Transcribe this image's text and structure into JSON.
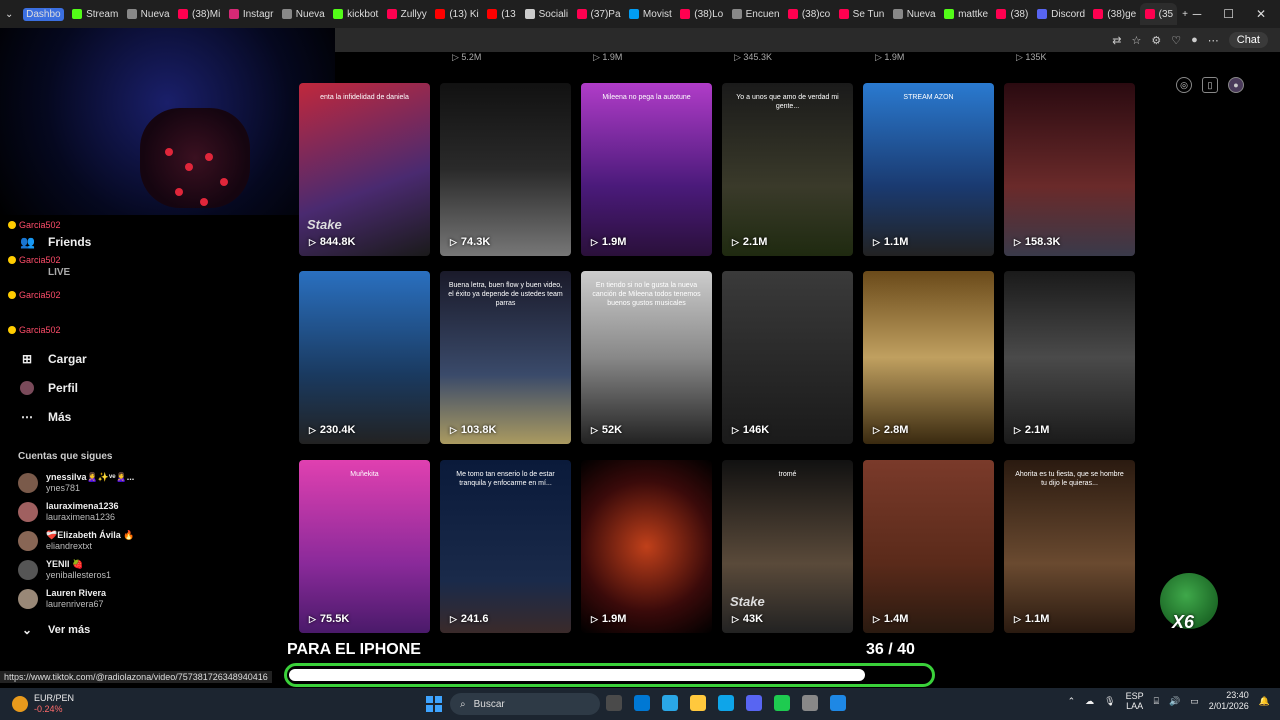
{
  "browser": {
    "tabs": [
      {
        "label": "Dashbo",
        "color": "#3b6fe0",
        "active": false
      },
      {
        "label": "Stream",
        "color": "#53fc18"
      },
      {
        "label": "Nueva",
        "color": "#888888"
      },
      {
        "label": "(38)Mi",
        "color": "#ff0050"
      },
      {
        "label": "Instagr",
        "color": "#d62976"
      },
      {
        "label": "Nueva",
        "color": "#888888"
      },
      {
        "label": "kickbot",
        "color": "#53fc18"
      },
      {
        "label": "Zullyy",
        "color": "#ff0050"
      },
      {
        "label": "(13) Ki",
        "color": "#ff0000"
      },
      {
        "label": "(13",
        "color": "#ff0000"
      },
      {
        "label": "Sociali",
        "color": "#cccccc"
      },
      {
        "label": "(37)Pa",
        "color": "#ff0050"
      },
      {
        "label": "Movist",
        "color": "#019df4"
      },
      {
        "label": "(38)Lo",
        "color": "#ff0050"
      },
      {
        "label": "Encuen",
        "color": "#888888"
      },
      {
        "label": "(38)co",
        "color": "#ff0050"
      },
      {
        "label": "Se Tun",
        "color": "#ff0050"
      },
      {
        "label": "Nueva",
        "color": "#888888"
      },
      {
        "label": "mattke",
        "color": "#53fc18"
      },
      {
        "label": "(38)",
        "color": "#ff0050"
      },
      {
        "label": "Discord",
        "color": "#5865f2"
      },
      {
        "label": "(38)ge",
        "color": "#ff0050"
      },
      {
        "label": "(35",
        "color": "#ff0050",
        "active": true
      }
    ],
    "chat_label": "Chat"
  },
  "sidebar": {
    "donors": [
      "Garcia502",
      "Garcia502",
      "Garcia502",
      "Garcia502"
    ],
    "items": [
      {
        "label": "Friends",
        "icon": "friends-icon",
        "glyph": "♟"
      },
      {
        "label": "LIVE",
        "icon": "live-icon",
        "glyph": ""
      },
      {
        "label": "Cargar",
        "icon": "upload-icon",
        "glyph": "➕"
      },
      {
        "label": "Perfil",
        "icon": "profile-icon",
        "glyph": "●"
      },
      {
        "label": "Más",
        "icon": "more-icon",
        "glyph": "⋯"
      }
    ],
    "following_title": "Cuentas que sigues",
    "accounts": [
      {
        "name": "ynessilva🙎‍♀️✨ᵛᵉ🙎‍♀️...",
        "handle": "ynes781",
        "color": "#7a5a4a"
      },
      {
        "name": "lauraximena1236",
        "handle": "lauraximena1236",
        "color": "#a06060"
      },
      {
        "name": "❤️‍🩹Elizabeth Ávila 🔥",
        "handle": "eliandrextxt",
        "color": "#886655"
      },
      {
        "name": "YENII 🍓",
        "handle": "yeniballesteros1",
        "color": "#555555"
      },
      {
        "name": "Lauren Rivera",
        "handle": "laurenrivera67",
        "color": "#998877"
      }
    ],
    "see_more": "Ver más"
  },
  "top_views": [
    "5.2M",
    "1.9M",
    "345.3K",
    "1.9M",
    "135K"
  ],
  "videos": [
    {
      "views": "844.8K",
      "caption": "enta la infidelidad de daniela",
      "bg": "linear-gradient(160deg,#c0283c,#4a2a70 60%,#1a1a1a)",
      "stake": true
    },
    {
      "views": "74.3K",
      "caption": "",
      "bg": "linear-gradient(180deg,#111,#2a2a2a 50%,#777)"
    },
    {
      "views": "1.9M",
      "caption": "Mileena no pega la autotune",
      "bg": "linear-gradient(180deg,#b03cc8,#4a1a7a 60%,#2a103a)"
    },
    {
      "views": "2.1M",
      "caption": "Yo a unos que amo de verdad mi gente...",
      "bg": "linear-gradient(180deg,#1a1a1a,#3a3a2a 60%,#1f2a10)"
    },
    {
      "views": "1.1M",
      "caption": "STREAM AZON",
      "bg": "linear-gradient(180deg,#2a7ad0,#1a3a70 60%,#222)"
    },
    {
      "views": "158.3K",
      "caption": "",
      "bg": "linear-gradient(180deg,#2a0a10,#6a2a2a 60%,#3a3a4a)"
    },
    {
      "views": "230.4K",
      "caption": "",
      "bg": "linear-gradient(180deg,#2a70c0,#1a3a60 60%,#222)"
    },
    {
      "views": "103.8K",
      "caption": "Buena letra, buen flow y buen video, el éxito ya depende de ustedes team parras",
      "bg": "linear-gradient(180deg,#1a1a2a,#3a4a6a 60%,#aa9a60)"
    },
    {
      "views": "52K",
      "caption": "En tiendo si no le gusta la nueva canción de Mileena todos tenemos buenos gustos musicales",
      "bg": "linear-gradient(180deg,#ccc,#888 50%,#222)"
    },
    {
      "views": "146K",
      "caption": "",
      "bg": "linear-gradient(180deg,#3a3a3a,#1a1a1a)"
    },
    {
      "views": "2.8M",
      "caption": "",
      "bg": "linear-gradient(180deg,#6a4a1a,#c0a060 50%,#3a2a10)"
    },
    {
      "views": "2.1M",
      "caption": "",
      "bg": "linear-gradient(180deg,#1a1a1a,#4a4a4a 50%,#1a1a1a)"
    },
    {
      "views": "75.5K",
      "caption": "Muñekita",
      "bg": "linear-gradient(180deg,#e040b0,#8a2a9a 60%,#4a1a6a)"
    },
    {
      "views": "241.6",
      "caption": "Me tomo tan enserio lo de estar tranquila y enfocarme en mí...",
      "bg": "linear-gradient(180deg,#0a1a3a,#1a2a4a 70%,#3a2a2a)"
    },
    {
      "views": "1.9M",
      "caption": "",
      "bg": "radial-gradient(circle at 50% 50%,#c0401a,#3a0a0a 60%,#000)"
    },
    {
      "views": "43K",
      "caption": "tromé",
      "bg": "linear-gradient(180deg,#111,#5a4a3a 60%,#222)",
      "stake": true
    },
    {
      "views": "1.4M",
      "caption": "",
      "bg": "linear-gradient(180deg,#7a3a2a,#5a2a1a 60%,#2a1a10)"
    },
    {
      "views": "1.1M",
      "caption": "Ahorita es tu fiesta, que se hombre tu dijo le quieras...",
      "bg": "linear-gradient(180deg,#2a1a10,#6a4a30 60%,#2a1a10)"
    }
  ],
  "overlay": {
    "title": "PARA EL IPHONE",
    "count": "36",
    "total": "/ 40",
    "progress": 0.9
  },
  "status_url": "https://www.tiktok.com/@radiolazona/video/75738172634894041​6",
  "taskbar": {
    "ticker_name": "EUR/PEN",
    "ticker_change": "-0.24%",
    "search_placeholder": "Buscar",
    "lang_top": "ESP",
    "lang_bottom": "LAA",
    "time": "23:40",
    "date": "2/01/2026",
    "apps": [
      "#4a4a4a",
      "#0078d4",
      "#2aa7e6",
      "#ffc83d",
      "#0ea5e9",
      "#5865f2",
      "#1ecb50",
      "#888888",
      "#1e88e5"
    ]
  }
}
